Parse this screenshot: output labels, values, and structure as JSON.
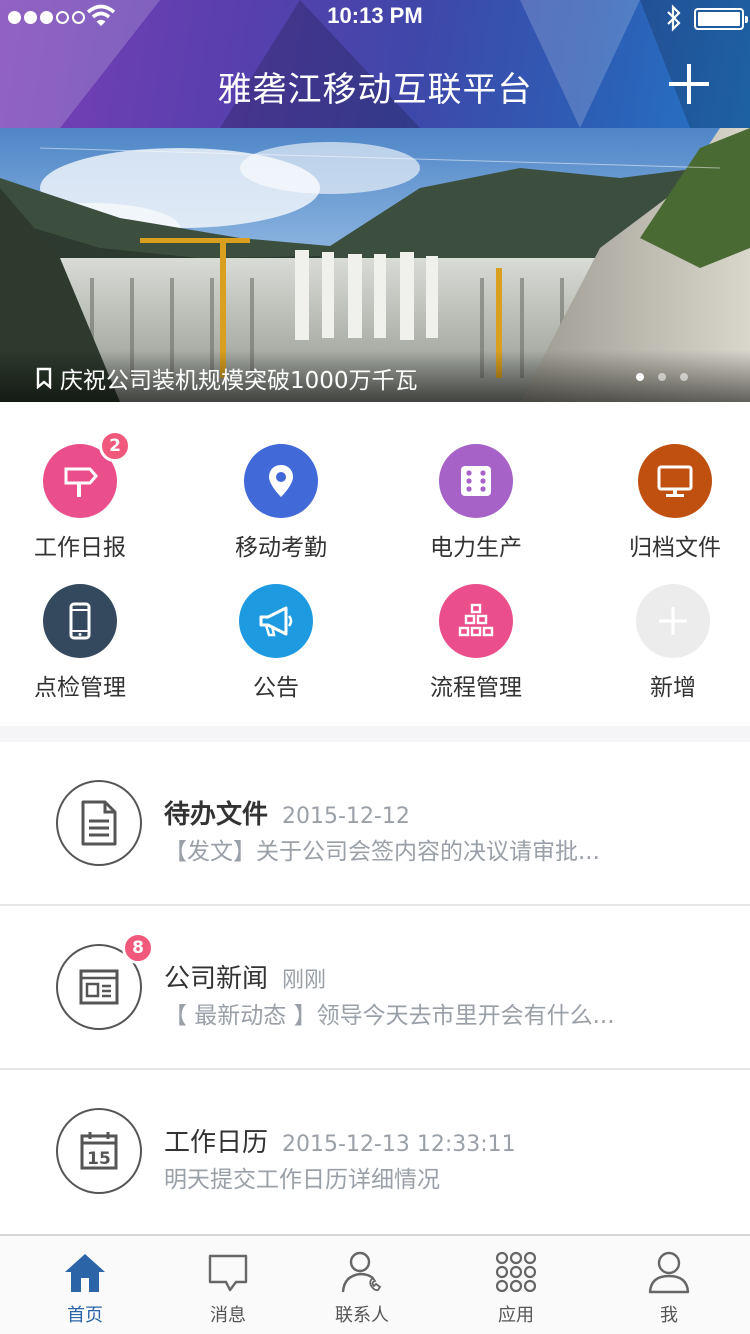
{
  "status_bar": {
    "time": "10:13 PM"
  },
  "header": {
    "title": "雅砻江移动互联平台"
  },
  "banner": {
    "caption": "庆祝公司装机规模突破1000万千瓦",
    "pages": 3,
    "active_page": 1
  },
  "grid": [
    {
      "label": "工作日报",
      "icon": "signpost-icon",
      "color": "#ea4f8b",
      "badge": "2"
    },
    {
      "label": "移动考勤",
      "icon": "location-pin-icon",
      "color": "#4169d8",
      "badge": ""
    },
    {
      "label": "电力生产",
      "icon": "dice-icon",
      "color": "#a662c6",
      "badge": ""
    },
    {
      "label": "归档文件",
      "icon": "monitor-icon",
      "color": "#bf5010",
      "badge": ""
    },
    {
      "label": "点检管理",
      "icon": "phone-icon",
      "color": "#34495e",
      "badge": ""
    },
    {
      "label": "公告",
      "icon": "megaphone-icon",
      "color": "#1e9ae0",
      "badge": ""
    },
    {
      "label": "流程管理",
      "icon": "org-chart-icon",
      "color": "#ea4f8b",
      "badge": ""
    },
    {
      "label": "新增",
      "icon": "plus-icon",
      "color": "#ececec",
      "badge": ""
    }
  ],
  "list": [
    {
      "title": "待办文件",
      "time": "2015-12-12",
      "subtitle": "【发文】关于公司会签内容的决议请审批...",
      "icon": "document-icon",
      "badge": "",
      "bold": true
    },
    {
      "title": "公司新闻",
      "time": "刚刚",
      "subtitle": "【 最新动态 】领导今天去市里开会有什么...",
      "icon": "newspaper-icon",
      "badge": "8",
      "bold": false
    },
    {
      "title": "工作日历",
      "time": "2015-12-13 12:33:11",
      "subtitle": "明天提交工作日历详细情况",
      "icon": "calendar-icon",
      "badge": "",
      "bold": false,
      "calendar_day": "15"
    }
  ],
  "tabbar": [
    {
      "label": "首页",
      "icon": "home-icon",
      "active": true
    },
    {
      "label": "消息",
      "icon": "chat-bubble-icon",
      "active": false
    },
    {
      "label": "联系人",
      "icon": "contact-icon",
      "active": false
    },
    {
      "label": "应用",
      "icon": "apps-grid-icon",
      "active": false
    },
    {
      "label": "我",
      "icon": "user-icon",
      "active": false
    }
  ]
}
